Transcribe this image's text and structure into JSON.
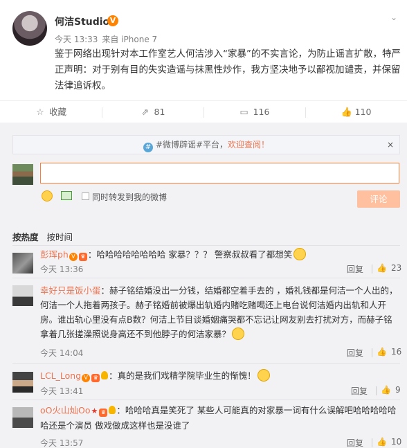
{
  "post": {
    "author": "何洁Studio",
    "verified_badge": "V",
    "time": "今天 13:33",
    "source": "来自 iPhone 7",
    "text": "鉴于网络出现针对本工作室艺人何洁涉入“家暴”的不实言论，为防止谣言扩散，特严正声明：对于别有目的失实造谣与抹黑性炒作，我方坚决地予以鄙视加谴责，并保留法律追诉权。"
  },
  "actions": {
    "favorite_label": "收藏",
    "repost_count": "81",
    "comment_count": "116",
    "like_count": "110"
  },
  "notice": {
    "prefix": "#微博辟谣#平台，",
    "link": "欢迎查阅！",
    "close": "×"
  },
  "composer": {
    "input_value": "",
    "forward_label": "同时转发到我的微博",
    "submit_label": "评论"
  },
  "sort": {
    "hot_label": "按热度",
    "time_label": "按时间"
  },
  "comments": [
    {
      "name": "彭珲ph",
      "text": "：哈哈哈哈哈哈哈哈 家暴？？？ 警察叔叔看了都想笑",
      "time": "今天 13:36",
      "reply": "回复",
      "likes": "23"
    },
    {
      "name": "幸好只是饭小蛋",
      "text": "：赫子铭结婚没出一分钱，结婚都空着手去的 ，婚礼钱都是何洁一个人出的，何洁一个人拖着两孩子。赫子铭婚前被爆出轨婚内赌吃赌喝还上电台说何洁婚内出轨和人开房。谁出轨心里没有点B数？何洁上节目谈婚姻痛哭都不忘记让网友别去打扰对方，而赫子铭拿着几张搓澡照说身高还不到他脖子的何洁家暴？",
      "time": "今天 14:04",
      "reply": "回复",
      "likes": "16"
    },
    {
      "name": "LCL_Long",
      "text": "：真的是我们戏精学院毕业生的惭愧！",
      "time": "今天 13:41",
      "reply": "回复",
      "likes": "9"
    },
    {
      "name": "oO火山灿Oo",
      "text": "：哈哈哈真是笑死了 某些人可能真的对家暴一词有什么误解吧哈哈哈哈哈哈还是个演员 做戏做成这样也是没谁了",
      "time": "今天 13:57",
      "reply": "回复",
      "likes": "10"
    }
  ]
}
